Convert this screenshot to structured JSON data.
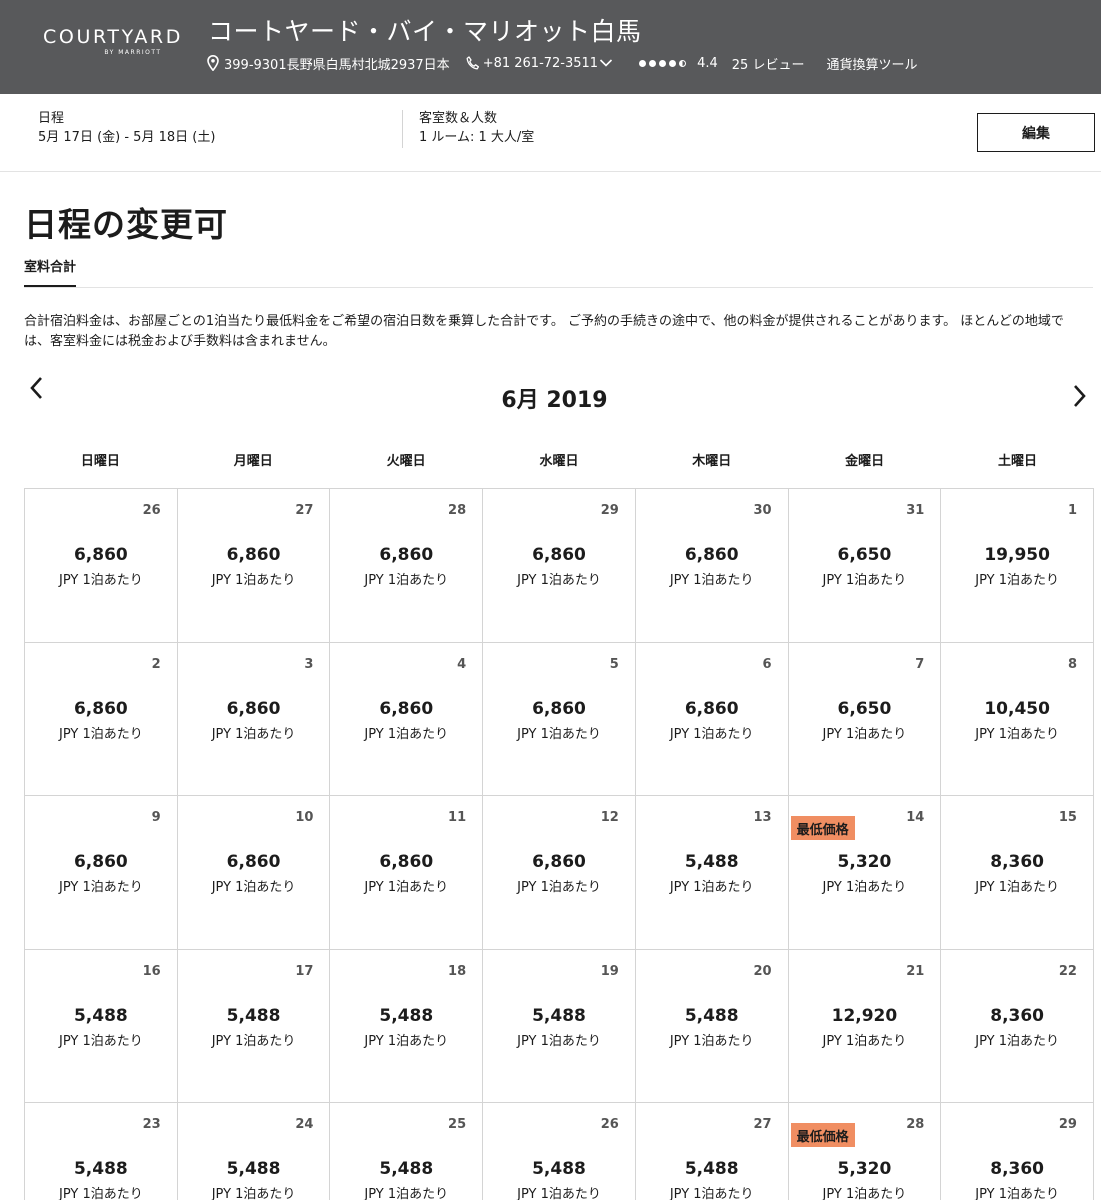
{
  "header": {
    "logo": "COURTYARD",
    "logo_sub": "BY MARRIOTT",
    "hotel_name": "コートヤード・バイ・マリオット白馬",
    "address": "399-9301長野県白馬村北城2937日本",
    "phone": "+81 261-72-3511",
    "rating": "4.4",
    "reviews": "25 レビュー",
    "currency_tool": "通貨換算ツール"
  },
  "summary": {
    "dates_label": "日程",
    "dates_value": "5月 17日 (金) - 5月 18日 (土)",
    "guests_label": "客室数＆人数",
    "guests_value": "1 ルーム: 1 大人/室",
    "edit_label": "編集"
  },
  "page_title": "日程の変更可",
  "tab_label": "室料合計",
  "description": "合計宿泊料金は、お部屋ごとの1泊当たり最低料金をご希望の宿泊日数を乗算した合計です。 ご予約の手続きの途中で、他の料金が提供されることがあります。 ほとんどの地域では、客室料金には税金および手数料は含まれません。",
  "month_title": "6月 2019",
  "weekdays": [
    "日曜日",
    "月曜日",
    "火曜日",
    "水曜日",
    "木曜日",
    "金曜日",
    "土曜日"
  ],
  "per_night": "JPY 1泊あたり",
  "lowest_badge": "最低価格",
  "days": [
    {
      "day": "26",
      "price": "6,860"
    },
    {
      "day": "27",
      "price": "6,860"
    },
    {
      "day": "28",
      "price": "6,860"
    },
    {
      "day": "29",
      "price": "6,860"
    },
    {
      "day": "30",
      "price": "6,860"
    },
    {
      "day": "31",
      "price": "6,650"
    },
    {
      "day": "1",
      "price": "19,950"
    },
    {
      "day": "2",
      "price": "6,860"
    },
    {
      "day": "3",
      "price": "6,860"
    },
    {
      "day": "4",
      "price": "6,860"
    },
    {
      "day": "5",
      "price": "6,860"
    },
    {
      "day": "6",
      "price": "6,860"
    },
    {
      "day": "7",
      "price": "6,650"
    },
    {
      "day": "8",
      "price": "10,450"
    },
    {
      "day": "9",
      "price": "6,860"
    },
    {
      "day": "10",
      "price": "6,860"
    },
    {
      "day": "11",
      "price": "6,860"
    },
    {
      "day": "12",
      "price": "6,860"
    },
    {
      "day": "13",
      "price": "5,488"
    },
    {
      "day": "14",
      "price": "5,320",
      "lowest": true
    },
    {
      "day": "15",
      "price": "8,360"
    },
    {
      "day": "16",
      "price": "5,488"
    },
    {
      "day": "17",
      "price": "5,488"
    },
    {
      "day": "18",
      "price": "5,488"
    },
    {
      "day": "19",
      "price": "5,488"
    },
    {
      "day": "20",
      "price": "5,488"
    },
    {
      "day": "21",
      "price": "12,920"
    },
    {
      "day": "22",
      "price": "8,360"
    },
    {
      "day": "23",
      "price": "5,488"
    },
    {
      "day": "24",
      "price": "5,488"
    },
    {
      "day": "25",
      "price": "5,488"
    },
    {
      "day": "26",
      "price": "5,488"
    },
    {
      "day": "27",
      "price": "5,488"
    },
    {
      "day": "28",
      "price": "5,320",
      "lowest": true
    },
    {
      "day": "29",
      "price": "8,360"
    }
  ],
  "colors": {
    "header_bg": "#58595b",
    "badge_bg": "#f08e62",
    "border": "#d4d4d4"
  },
  "icons": [
    "location-pin-icon",
    "phone-icon",
    "chevron-down-icon",
    "chevron-left-icon",
    "chevron-right-icon"
  ]
}
